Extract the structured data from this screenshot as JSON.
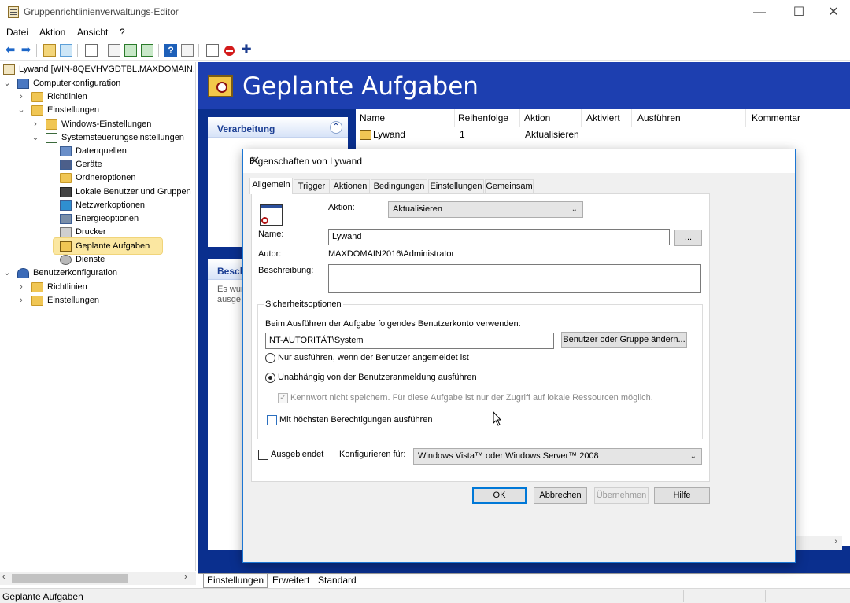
{
  "window": {
    "title": "Gruppenrichtlinienverwaltungs-Editor",
    "minimize": "—",
    "maximize": "☐",
    "close": "✕"
  },
  "menu": {
    "file": "Datei",
    "action": "Aktion",
    "view": "Ansicht",
    "help": "?"
  },
  "tree": {
    "root": "Lywand [WIN-8QEVHVGDTBL.MAXDOMAIN.",
    "computer_config": "Computerkonfiguration",
    "policies": "Richtlinien",
    "preferences": "Einstellungen",
    "windows_settings": "Windows-Einstellungen",
    "control_panel": "Systemsteuerungseinstellungen",
    "data_sources": "Datenquellen",
    "devices": "Geräte",
    "folder_options": "Ordneroptionen",
    "local_users": "Lokale Benutzer und Gruppen",
    "network_options": "Netzwerkoptionen",
    "power_options": "Energieoptionen",
    "printers": "Drucker",
    "scheduled_tasks": "Geplante Aufgaben",
    "services": "Dienste",
    "user_config": "Benutzerkonfiguration",
    "user_policies": "Richtlinien",
    "user_preferences": "Einstellungen"
  },
  "rightpane": {
    "title": "Geplante Aufgaben",
    "task_panel_header": "Verarbeitung",
    "desc_panel_header": "Besch",
    "desc_text": "Es wur\nausge",
    "columns": [
      "Name",
      "Reihenfolge",
      "Aktion",
      "Aktiviert",
      "Ausführen",
      "Kommentar"
    ],
    "row": {
      "name": "Lywand",
      "order": "1",
      "action": "Aktualisieren"
    }
  },
  "bottom_tabs": [
    "Einstellungen",
    "Erweitert",
    "Standard"
  ],
  "status": "Geplante Aufgaben",
  "dialog": {
    "title": "Eigenschaften von Lywand",
    "tabs": [
      "Allgemein",
      "Trigger",
      "Aktionen",
      "Bedingungen",
      "Einstellungen",
      "Gemeinsam"
    ],
    "action_label": "Aktion:",
    "action_value": "Aktualisieren",
    "name_label": "Name:",
    "name_value": "Lywand",
    "browse": "...",
    "author_label": "Autor:",
    "author_value": "MAXDOMAIN2016\\Administrator",
    "desc_label": "Beschreibung:",
    "security_group": "Sicherheitsoptionen",
    "account_label": "Beim Ausführen der Aufgabe folgendes Benutzerkonto verwenden:",
    "account_value": "NT-AUTORITÄT\\System",
    "change_user": "Benutzer oder Gruppe ändern...",
    "radio_logged_on": "Nur ausführen, wenn der Benutzer angemeldet ist",
    "radio_independent": "Unabhängig von der Benutzeranmeldung ausführen",
    "no_store_password": "Kennwort nicht speichern. Für diese Aufgabe ist nur der Zugriff auf lokale Ressourcen möglich.",
    "highest_privileges": "Mit höchsten Berechtigungen ausführen",
    "hidden": "Ausgeblendet",
    "configure_label": "Konfigurieren für:",
    "configure_value": "Windows Vista™ oder Windows Server™ 2008",
    "ok": "OK",
    "cancel": "Abbrechen",
    "apply": "Übernehmen",
    "help": "Hilfe"
  }
}
